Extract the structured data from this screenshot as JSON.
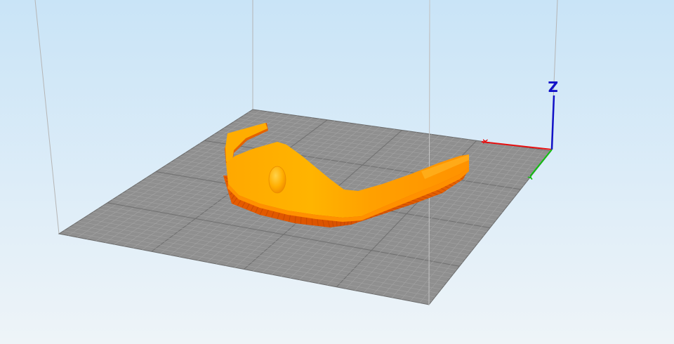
{
  "viewer": {
    "background_top": "#c9e4f7",
    "background_bottom": "#eef4f8",
    "bed_color": "#8e8e8e",
    "grid_minor_color": "#a3a3a3",
    "grid_major_color": "#6f6f6f",
    "frame_color": "#b9b9b9"
  },
  "model": {
    "color_light": "#ffb000",
    "color_mid": "#ff9a00",
    "color_dark": "#e55a00",
    "color_shadow": "#c64800"
  },
  "axes": {
    "z": {
      "label": "Z",
      "color": "#1212c8"
    },
    "x": {
      "label": "X",
      "color": "#e81010"
    },
    "y": {
      "label": "Y",
      "color": "#10c010"
    }
  }
}
